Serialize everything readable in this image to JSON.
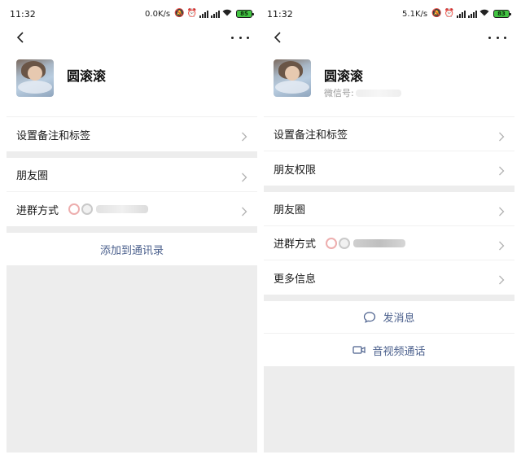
{
  "left": {
    "status": {
      "time": "11:32",
      "speed": "0.0K/s",
      "battery": "85"
    },
    "profile": {
      "name": "圆滚滚"
    },
    "rows_group1": [
      {
        "label": "设置备注和标签"
      }
    ],
    "rows_group2": [
      {
        "label": "朋友圈"
      },
      {
        "label": "进群方式"
      }
    ],
    "action_add": "添加到通讯录"
  },
  "right": {
    "status": {
      "time": "11:32",
      "speed": "5.1K/s",
      "battery": "83"
    },
    "profile": {
      "name": "圆滚滚",
      "id_prefix": "微信号:"
    },
    "rows_group1": [
      {
        "label": "设置备注和标签"
      },
      {
        "label": "朋友权限"
      }
    ],
    "rows_group2": [
      {
        "label": "朋友圈"
      },
      {
        "label": "进群方式"
      },
      {
        "label": "更多信息"
      }
    ],
    "action_message": "发消息",
    "action_call": "音视频通话"
  },
  "icons": {
    "back": "back-arrow-icon",
    "more": "more-dots-icon",
    "chevron": "chevron-right-icon",
    "message": "chat-bubble-icon",
    "video": "video-camera-icon"
  },
  "colors": {
    "link": "#4a5f8c",
    "background": "#ededed",
    "battery": "#42c442"
  }
}
